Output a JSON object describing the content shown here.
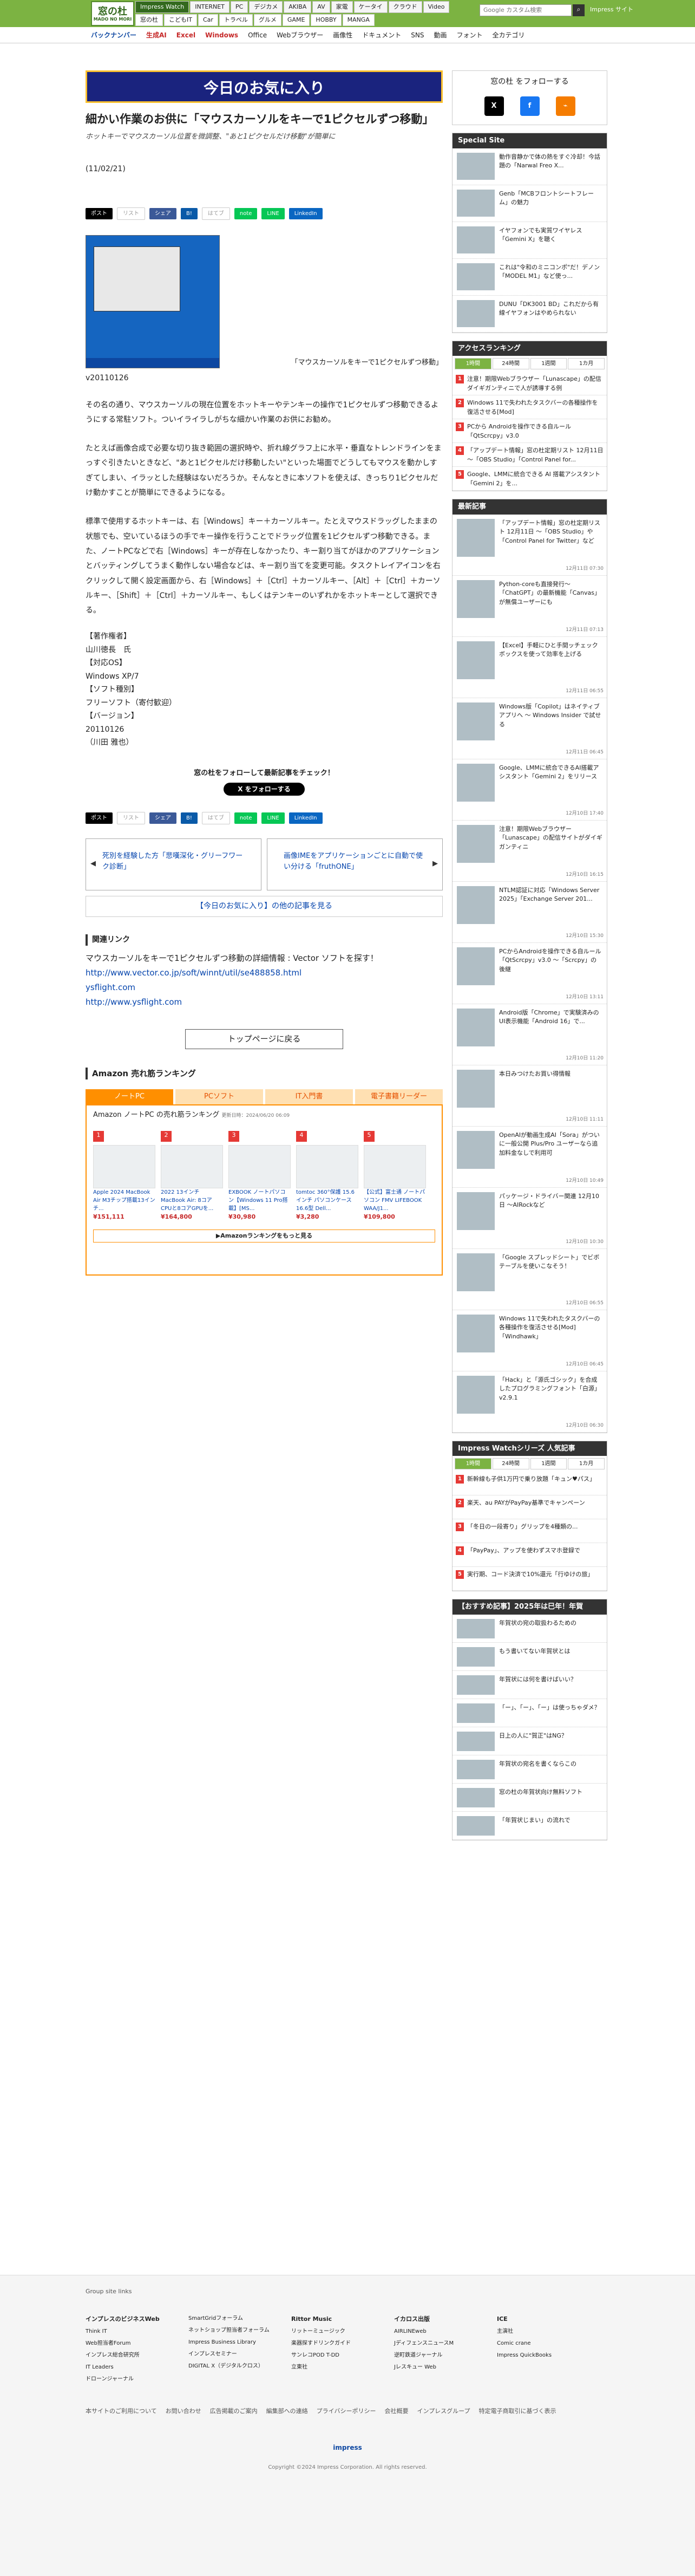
{
  "header": {
    "logo": "窓の杜",
    "logo_sub": "MADO NO MORI",
    "nav1": [
      "Impress Watch",
      "INTERNET",
      "PC",
      "デジカメ",
      "AKIBA",
      "AV",
      "家電",
      "ケータイ",
      "クラウド",
      "Video"
    ],
    "nav2": [
      "窓の杜",
      "こどもIT",
      "Car",
      "トラベル",
      "グルメ",
      "GAME",
      "HOBBY",
      "MANGA"
    ],
    "search_placeholder": "Google カスタム検索",
    "brand": "Impress サイト"
  },
  "subnav": [
    "バックナンバー",
    "生成AI",
    "Excel",
    "Windows",
    "Office",
    "Webブラウザー",
    "画像性",
    "ドキュメント",
    "SNS",
    "動画",
    "フォント",
    "全カテゴリ"
  ],
  "article": {
    "banner": "今日のお気に入り",
    "title": "細かい作業のお供に「マウスカーソルをキーで1ピクセルずつ移動」",
    "lead": "ホットキーでマウスカーソル位置を微調整、\"あと1ピクセルだけ移動\"が簡単に",
    "date": "(11/02/21)",
    "share": [
      "ポスト",
      "リスト",
      "シェア",
      "B!",
      "はてブ",
      "note",
      "LINE",
      "LinkedIn"
    ],
    "caption": "「マウスカーソルをキーで1ピクセルずつ移動」",
    "version": "v20110126",
    "p1": "その名の通り、マウスカーソルの現在位置をホットキーやテンキーの操作で1ピクセルずつ移動できるようにする常駐ソフト。ついイライラしがちな細かい作業のお供にお勧め。",
    "p2": "たとえば画像合成で必要な切り抜き範囲の選択時や、折れ線グラフ上に水平・垂直なトレンドラインをまっすぐ引きたいときなど、\"あと1ピクセルだけ移動したい\"といった場面でどうしてもマウスを動かしすぎてしまい、イラッとした経験はないだろうか。そんなときに本ソフトを使えば、きっちり1ピクセルだけ動かすことが簡単にできるようになる。",
    "p3": "標準で使用するホットキーは、右［Windows］キー＋カーソルキー。たとえマウスドラッグしたままの状態でも、空いているほうの手でキー操作を行うことでドラッグ位置を1ピクセルずつ移動できる。また、ノートPCなどで右［Windows］キーが存在しなかったり、キー割り当てがほかのアプリケーションとバッティングしてうまく動作しない場合などは、キー割り当てを変更可能。タスクトレイアイコンを右クリックして開く設定画面から、右［Windows］＋［Ctrl］＋カーソルキー、［Alt］＋［Ctrl］＋カーソルキー、［Shift］＋［Ctrl］＋カーソルキー、もしくはテンキーのいずれかをホットキーとして選択できる。",
    "info": [
      "【著作権者】",
      "山川徳長　氏",
      "【対応OS】",
      "Windows XP/7",
      "【ソフト種別】",
      "フリーソフト（寄付歓迎）",
      "【バージョン】",
      "20110126"
    ],
    "author": "（川田 雅也）",
    "follow": "窓の杜をフォローして最新記事をチェック！",
    "follow_btn": "X をフォローする",
    "prev": "死別を経験した方「悲嘆深化・グリーフワーク診断」",
    "next": "画像IMEをアプリケーションごとに自動で使い分ける「fruthONE」",
    "more": "【今日のお気に入り】の他の記事を見る",
    "related_head": "関連リンク",
    "related": [
      "マウスカーソルをキーで1ピクセルずつ移動の詳細情報 : Vector ソフトを探す！",
      "http://www.vector.co.jp/soft/winnt/util/se488858.html",
      "ysflight.com",
      "http://www.ysflight.com"
    ],
    "totop": "トップページに戻る"
  },
  "amazon": {
    "head": "Amazon 売れ筋ランキング",
    "tabs": [
      "ノートPC",
      "PCソフト",
      "IT入門書",
      "電子書籍リーダー"
    ],
    "sub": "Amazon ノートPC の売れ筋ランキング",
    "updated": "更新日時：2024/06/20 06:09",
    "items": [
      {
        "rank": "1",
        "name": "Apple 2024 MacBook Air M3チップ搭載13インチ...",
        "price": "¥151,111"
      },
      {
        "rank": "2",
        "name": "2022 13インチ MacBook Air: 8コアCPUと8コアGPUを...",
        "price": "¥164,800"
      },
      {
        "rank": "3",
        "name": "EXBOOK ノートパソコン【Windows 11 Pro搭載】[MS...",
        "price": "¥30,980"
      },
      {
        "rank": "4",
        "name": "tomtoc 360°保護 15.6インチ パソコンケース 16.6型 Dell...",
        "price": "¥3,280"
      },
      {
        "rank": "5",
        "name": "【公式】富士通 ノートパソコン FMV LIFEBOOK WAA/J1...",
        "price": "¥109,800"
      }
    ],
    "more": "▶Amazonランキングをもっと見る"
  },
  "sidebar": {
    "follow": "窓の杜 をフォローする",
    "special_head": "Special Site",
    "special": [
      "動作音静かで体の熱をすぐ冷却！今話題の「Narwal Freo X...",
      "Genb「MCBフロントシートフレーム」の魅力",
      "イヤフォンでも実質ワイヤレス「Gemini X」を聴く",
      "これは\"令和のミニコンポ\"だ！デノン「MODEL M1」など使っ...",
      "DUNU「DK3001 BD」これだから有線イヤフォンはやめられない"
    ],
    "access_head": "アクセスランキング",
    "access_tabs": [
      "1時間",
      "24時間",
      "1週間",
      "1カ月"
    ],
    "access": [
      "注意！期限Webブラウザー「Lunascape」の配信ダイギガンティニで人が誘導する例",
      "Windows 11で失われたタスクバーの各種操作を復活させる[Mod]",
      "PCから Androidを操作できる自ルール「QtScrcpy」v3.0",
      "「アップデート情報」窓の杜定期リスト 12月11日 ～「OBS Studio」「Control Panel for...",
      "Google、LMMに統合できる AI 搭載アシスタント「Gemini 2」を..."
    ],
    "latest_head": "最新記事",
    "latest": [
      {
        "t": "「アップデート情報」窓の杜定期リスト 12月11日 ～「OBS Studio」や「Control Panel for Twitter」など",
        "d": "12月11日 07:30"
      },
      {
        "t": "Python-coreも直接発行～「ChatGPT」の最新機能「Canvas」が無償ユーザーにも",
        "d": "12月11日 07:13"
      },
      {
        "t": "【Excel】手軽にひと手間ッチェックボックスを使って効率を上げる",
        "d": "12月11日 06:55"
      },
      {
        "t": "Windows版「Copilot」はネイティブアプリへ ～ Windows Insider で試せる",
        "d": "12月11日 06:45"
      },
      {
        "t": "Google、LMMに統合できるAI搭載アシスタント「Gemini 2」をリリース",
        "d": "12月10日 17:40"
      },
      {
        "t": "注意！期限Webブラウザー「Lunascape」の配信サイトがダイギガンティニ",
        "d": "12月10日 16:15"
      },
      {
        "t": "NTLM認証に対応「Windows Server 2025」「Exchange Server 201...",
        "d": "12月10日 15:30"
      },
      {
        "t": "PCからAndroidを操作できる自ルール「QtScrcpy」v3.0 ～「Scrcpy」の後継",
        "d": "12月10日 13:11"
      },
      {
        "t": "Android版「Chrome」で実験済みのUI表示機能「Android 16」で...",
        "d": "12月10日 11:20"
      },
      {
        "t": "本日みつけたお買い得情報",
        "d": "12月10日 11:11"
      },
      {
        "t": "OpenAIが動画生成AI「Sora」がついに一般公開 Plus/Pro ユーザーなら追加料金なしで利用可",
        "d": "12月10日 10:49"
      },
      {
        "t": "パッケージ・ドライバー関連 12月10日 ～AIRockなど",
        "d": "12月10日 10:30"
      },
      {
        "t": "「Google スプレッドシート」でビボテーブルを使いこなそう！",
        "d": "12月10日 06:55"
      },
      {
        "t": "Windows 11で失われたタスクバーの各種操作を復活させる[Mod]「Windhawk」",
        "d": "12月10日 06:45"
      },
      {
        "t": "「Hack」と「源氏ゴシック」を合成したプログラミングフォント「白源」v2.9.1",
        "d": "12月10日 06:30"
      }
    ],
    "impress_head": "Impress Watchシリーズ 人気記事",
    "impress_tabs": [
      "1時間",
      "24時間",
      "1週間",
      "1カ月"
    ],
    "impress": [
      "新幹線も子供1万円で乗り放題「キュン♥パス」",
      "楽天、au PAYがPayPay基準でキャンペーン",
      "「冬日の一段寄り」グリップを4種類の...",
      "「PayPay」、アップを使わずスマホ登録で",
      "実行期、コード決済で10%還元「行ゆけの旅」"
    ],
    "osusume_head": "【おすすめ記事】2025年は巳年！年賀",
    "osusume": [
      "年賀状の宛の取扱わるための",
      "もう書いてない年賀状とは",
      "年賀状には何を書けばいい？",
      "「ー」、「ー」、「ー」は使っちゃダメ？",
      "日上の人に\"賀正\"はNG？",
      "年賀状の宛名を書くならこの",
      "窓の杜の年賀状向け無料ソフト",
      "「年賀状じまい」の流れで"
    ]
  },
  "footer": {
    "group": "Group site links",
    "cols": [
      {
        "h": "インプレスのビジネスWeb",
        "items": [
          "Think IT",
          "Web担当者Forum",
          "インプレス総合研究所",
          "IT Leaders",
          "ドローンジャーナル"
        ]
      },
      {
        "h": "",
        "items": [
          "SmartGridフォーラム",
          "ネットショップ担当者フォーラム",
          "Impress Business Library",
          "インプレスセミナー",
          "DIGITAL X（デジタルクロス）"
        ]
      },
      {
        "h": "Rittor Music",
        "items": [
          "リットーミュージック",
          "楽器探すドリンクガイド",
          "サンレコPOD T-DD",
          "立東社"
        ]
      },
      {
        "h": "イカロス出版",
        "items": [
          "AIRLINEweb",
          "JディフェンスニュースM",
          "逆町鉄道ジャーナル",
          "Jレスキュー Web"
        ]
      },
      {
        "h": "ICE",
        "items": [
          "主演社",
          "Comic crane",
          "Impress QuickBooks"
        ]
      }
    ],
    "links": [
      "本サイトのご利用について",
      "お問い合わせ",
      "広告掲載のご案内",
      "編集部への連絡",
      "プライバシーポリシー",
      "会社概要",
      "インプレスグループ",
      "特定電子商取引に基づく表示"
    ],
    "copy": "Copyright ©2024 Impress Corporation. All rights reserved.",
    "impress": "impress"
  }
}
